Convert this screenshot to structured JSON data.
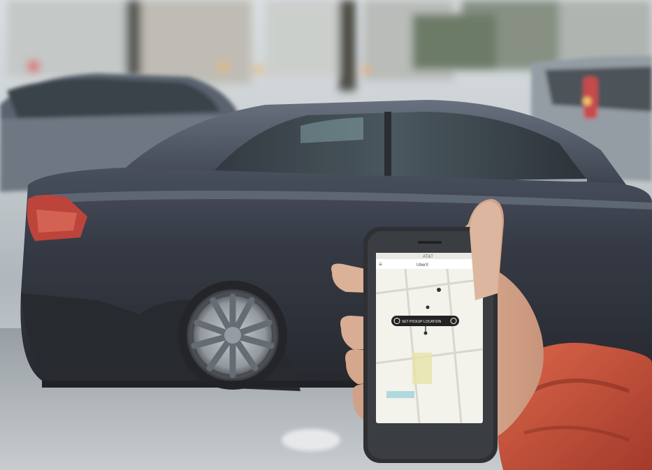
{
  "phone_screen": {
    "status_bar": "AT&T",
    "header_title": "UberX",
    "pickup_button_label": "SET PICKUP LOCATION"
  },
  "colors": {
    "car_body": "#1f2430",
    "sky_haze": "#cfd6da",
    "phone_body": "#1d1f22",
    "map_background": "#f2f1ea",
    "pickup_pill": "#111111",
    "jacket": "#c6402a",
    "skin": "#d6a78a",
    "tail_light": "#c33a2c"
  }
}
